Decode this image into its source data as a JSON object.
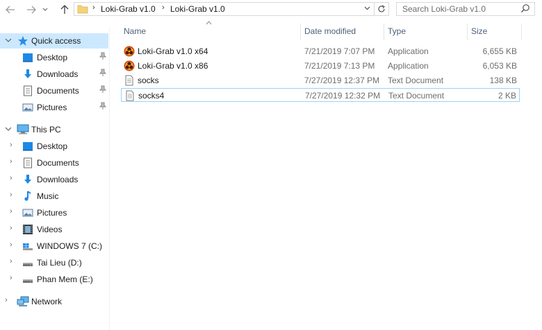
{
  "toolbar": {
    "back_icon": "back-arrow-icon",
    "forward_icon": "forward-arrow-icon",
    "recent_icon": "chevron-down-icon",
    "up_icon": "up-arrow-icon"
  },
  "address_bar": {
    "segments": [
      "Loki-Grab v1.0",
      "Loki-Grab v1.0"
    ],
    "refresh_icon": "refresh-icon",
    "dropdown_icon": "chevron-down-icon"
  },
  "search": {
    "placeholder": "Search Loki-Grab v1.0",
    "icon": "search-icon"
  },
  "sidebar": {
    "quick_access": {
      "label": "Quick access",
      "items": [
        {
          "label": "Desktop",
          "icon": "desktop-icon",
          "pinned": true
        },
        {
          "label": "Downloads",
          "icon": "downloads-icon",
          "pinned": true
        },
        {
          "label": "Documents",
          "icon": "documents-icon",
          "pinned": true
        },
        {
          "label": "Pictures",
          "icon": "pictures-icon",
          "pinned": true
        }
      ]
    },
    "this_pc": {
      "label": "This PC",
      "items": [
        {
          "label": "Desktop",
          "icon": "desktop-icon"
        },
        {
          "label": "Documents",
          "icon": "documents-icon"
        },
        {
          "label": "Downloads",
          "icon": "downloads-icon"
        },
        {
          "label": "Music",
          "icon": "music-icon"
        },
        {
          "label": "Pictures",
          "icon": "pictures-icon"
        },
        {
          "label": "Videos",
          "icon": "videos-icon"
        },
        {
          "label": "WINDOWS 7 (C:)",
          "icon": "system-drive-icon"
        },
        {
          "label": "Tai Lieu  (D:)",
          "icon": "drive-icon"
        },
        {
          "label": "Phan Mem (E:)",
          "icon": "drive-icon"
        }
      ]
    },
    "network": {
      "label": "Network",
      "icon": "network-icon"
    }
  },
  "columns": {
    "name": "Name",
    "date": "Date modified",
    "type": "Type",
    "size": "Size"
  },
  "files": [
    {
      "name": "Loki-Grab v1.0 x64",
      "date": "7/21/2019 7:07 PM",
      "type": "Application",
      "size": "6,655 KB",
      "icon": "biohazard-app-icon"
    },
    {
      "name": "Loki-Grab v1.0 x86",
      "date": "7/21/2019 7:13 PM",
      "type": "Application",
      "size": "6,053 KB",
      "icon": "biohazard-app-icon"
    },
    {
      "name": "socks",
      "date": "7/27/2019 12:37 PM",
      "type": "Text Document",
      "size": "138 KB",
      "icon": "text-document-icon"
    },
    {
      "name": "socks4",
      "date": "7/27/2019 12:32 PM",
      "type": "Text Document",
      "size": "2 KB",
      "icon": "text-document-icon"
    }
  ],
  "colors": {
    "selection": "#cce8ff",
    "focus_border": "#99d1ff",
    "header_text": "#4c607a",
    "accent_blue": "#1e88e5"
  }
}
